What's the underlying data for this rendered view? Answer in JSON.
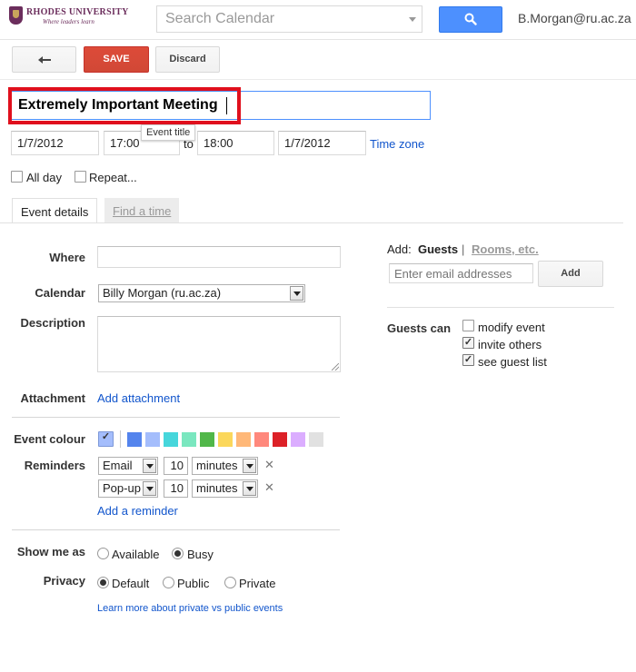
{
  "header": {
    "logo_name": "RHODES UNIVERSITY",
    "logo_tagline": "Where leaders learn",
    "search_placeholder": "Search Calendar",
    "user": "B.Morgan@ru.ac.za"
  },
  "toolbar": {
    "back_icon": "back-arrow-icon",
    "save_label": "SAVE",
    "discard_label": "Discard"
  },
  "event": {
    "title": "Extremely Important Meeting",
    "title_tooltip": "Event title",
    "start_date": "1/7/2012",
    "start_time": "17:00",
    "to_label": "to",
    "end_time": "18:00",
    "end_date": "1/7/2012",
    "time_zone_link": "Time zone",
    "all_day_label": "All day",
    "all_day_checked": false,
    "repeat_label": "Repeat...",
    "repeat_checked": false
  },
  "tabs": [
    {
      "label": "Event details",
      "active": true
    },
    {
      "label": "Find a time",
      "active": false
    }
  ],
  "details": {
    "where_label": "Where",
    "where_value": "",
    "calendar_label": "Calendar",
    "calendar_value": "Billy Morgan (ru.ac.za)",
    "description_label": "Description",
    "attachment_label": "Attachment",
    "attachment_link": "Add attachment",
    "colour_label": "Event colour",
    "colours": [
      "#5484ed",
      "#a4bdfc",
      "#46d6db",
      "#7ae7bf",
      "#51b749",
      "#fbd75b",
      "#ffb878",
      "#ff887c",
      "#dc2127",
      "#dbadff",
      "#e1e1e1"
    ],
    "default_colour": "#a4bdfc",
    "reminders_label": "Reminders",
    "reminders": [
      {
        "method": "Email",
        "amount": "10",
        "unit": "minutes"
      },
      {
        "method": "Pop-up",
        "amount": "10",
        "unit": "minutes"
      }
    ],
    "add_reminder_link": "Add a reminder",
    "show_me_as_label": "Show me as",
    "show_me_as_options": [
      "Available",
      "Busy"
    ],
    "show_me_as_selected": "Busy",
    "privacy_label": "Privacy",
    "privacy_options": [
      "Default",
      "Public",
      "Private"
    ],
    "privacy_selected": "Default",
    "privacy_learn_more": "Learn more about private vs public events"
  },
  "guests": {
    "add_label": "Add:",
    "guests_tab": "Guests",
    "separator": "|",
    "rooms_tab": "Rooms, etc.",
    "email_placeholder": "Enter email addresses",
    "add_button": "Add",
    "guests_can_label": "Guests can",
    "permissions": [
      {
        "label": "modify event",
        "checked": false
      },
      {
        "label": "invite others",
        "checked": true
      },
      {
        "label": "see guest list",
        "checked": true
      }
    ]
  }
}
